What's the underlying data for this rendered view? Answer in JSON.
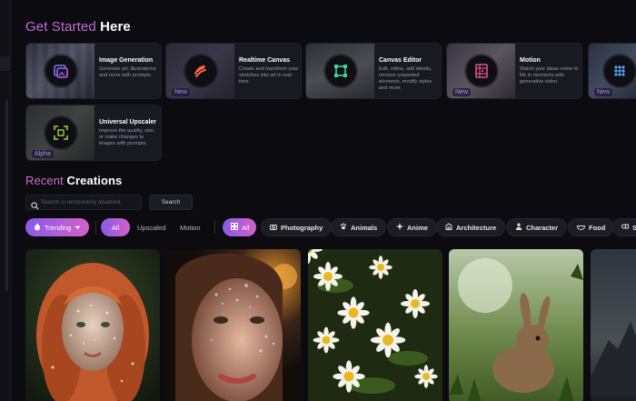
{
  "get_started": {
    "heading_accent": "Get Started",
    "heading_rest": "Here",
    "cards": [
      {
        "title": "Image Generation",
        "description": "Generate art, illustrations and more with prompts.",
        "badge": "",
        "icon": "image-generation-icon"
      },
      {
        "title": "Realtime Canvas",
        "description": "Create and transform your sketches into art in real-time.",
        "badge": "New",
        "icon": "brush-stroke-icon"
      },
      {
        "title": "Canvas Editor",
        "description": "Edit, refine, add details, remove unwanted elements, modify styles and more.",
        "badge": "",
        "icon": "canvas-frame-icon"
      },
      {
        "title": "Motion",
        "description": "Watch your ideas come to life in moments with generative video.",
        "badge": "New",
        "icon": "film-strip-icon"
      },
      {
        "title": "",
        "description": "",
        "badge": "New",
        "icon": "grid-dots-icon"
      },
      {
        "title": "Universal Upscaler",
        "description": "Improve the quality, size, or make changes to images with prompts.",
        "badge": "Alpha",
        "icon": "upscale-icon"
      }
    ]
  },
  "recent": {
    "heading_accent": "Recent",
    "heading_rest": "Creations",
    "search_placeholder": "Search is temporarily disabled.",
    "search_button": "Search"
  },
  "filters": {
    "sort": {
      "label": "Trending",
      "icon": "flame-icon"
    },
    "type_tabs": [
      "All",
      "Upscaled",
      "Motion"
    ],
    "categories": [
      {
        "label": "All",
        "icon": "grid-icon"
      },
      {
        "label": "Photography",
        "icon": "camera-icon"
      },
      {
        "label": "Animals",
        "icon": "paw-icon"
      },
      {
        "label": "Anime",
        "icon": "sparkle-icon"
      },
      {
        "label": "Architecture",
        "icon": "building-icon"
      },
      {
        "label": "Character",
        "icon": "person-icon"
      },
      {
        "label": "Food",
        "icon": "bowl-icon"
      },
      {
        "label": "S",
        "icon": "shapes-icon"
      }
    ]
  },
  "colors": {
    "accent_start": "#8a5ae8",
    "accent_end": "#d261c8",
    "background": "#0b0b10",
    "card": "#191922"
  }
}
